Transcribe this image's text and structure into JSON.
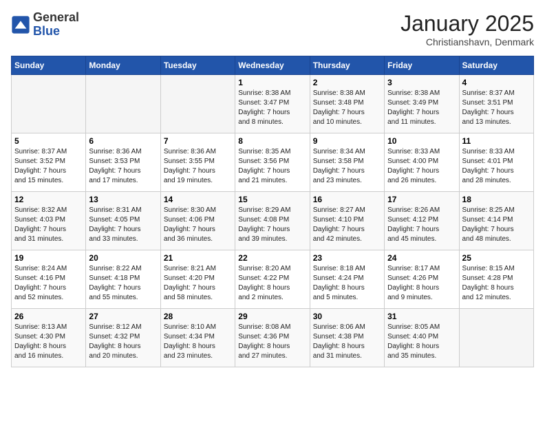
{
  "logo": {
    "general": "General",
    "blue": "Blue"
  },
  "title": "January 2025",
  "subtitle": "Christianshavn, Denmark",
  "weekdays": [
    "Sunday",
    "Monday",
    "Tuesday",
    "Wednesday",
    "Thursday",
    "Friday",
    "Saturday"
  ],
  "weeks": [
    [
      {
        "day": "",
        "info": ""
      },
      {
        "day": "",
        "info": ""
      },
      {
        "day": "",
        "info": ""
      },
      {
        "day": "1",
        "info": "Sunrise: 8:38 AM\nSunset: 3:47 PM\nDaylight: 7 hours\nand 8 minutes."
      },
      {
        "day": "2",
        "info": "Sunrise: 8:38 AM\nSunset: 3:48 PM\nDaylight: 7 hours\nand 10 minutes."
      },
      {
        "day": "3",
        "info": "Sunrise: 8:38 AM\nSunset: 3:49 PM\nDaylight: 7 hours\nand 11 minutes."
      },
      {
        "day": "4",
        "info": "Sunrise: 8:37 AM\nSunset: 3:51 PM\nDaylight: 7 hours\nand 13 minutes."
      }
    ],
    [
      {
        "day": "5",
        "info": "Sunrise: 8:37 AM\nSunset: 3:52 PM\nDaylight: 7 hours\nand 15 minutes."
      },
      {
        "day": "6",
        "info": "Sunrise: 8:36 AM\nSunset: 3:53 PM\nDaylight: 7 hours\nand 17 minutes."
      },
      {
        "day": "7",
        "info": "Sunrise: 8:36 AM\nSunset: 3:55 PM\nDaylight: 7 hours\nand 19 minutes."
      },
      {
        "day": "8",
        "info": "Sunrise: 8:35 AM\nSunset: 3:56 PM\nDaylight: 7 hours\nand 21 minutes."
      },
      {
        "day": "9",
        "info": "Sunrise: 8:34 AM\nSunset: 3:58 PM\nDaylight: 7 hours\nand 23 minutes."
      },
      {
        "day": "10",
        "info": "Sunrise: 8:33 AM\nSunset: 4:00 PM\nDaylight: 7 hours\nand 26 minutes."
      },
      {
        "day": "11",
        "info": "Sunrise: 8:33 AM\nSunset: 4:01 PM\nDaylight: 7 hours\nand 28 minutes."
      }
    ],
    [
      {
        "day": "12",
        "info": "Sunrise: 8:32 AM\nSunset: 4:03 PM\nDaylight: 7 hours\nand 31 minutes."
      },
      {
        "day": "13",
        "info": "Sunrise: 8:31 AM\nSunset: 4:05 PM\nDaylight: 7 hours\nand 33 minutes."
      },
      {
        "day": "14",
        "info": "Sunrise: 8:30 AM\nSunset: 4:06 PM\nDaylight: 7 hours\nand 36 minutes."
      },
      {
        "day": "15",
        "info": "Sunrise: 8:29 AM\nSunset: 4:08 PM\nDaylight: 7 hours\nand 39 minutes."
      },
      {
        "day": "16",
        "info": "Sunrise: 8:27 AM\nSunset: 4:10 PM\nDaylight: 7 hours\nand 42 minutes."
      },
      {
        "day": "17",
        "info": "Sunrise: 8:26 AM\nSunset: 4:12 PM\nDaylight: 7 hours\nand 45 minutes."
      },
      {
        "day": "18",
        "info": "Sunrise: 8:25 AM\nSunset: 4:14 PM\nDaylight: 7 hours\nand 48 minutes."
      }
    ],
    [
      {
        "day": "19",
        "info": "Sunrise: 8:24 AM\nSunset: 4:16 PM\nDaylight: 7 hours\nand 52 minutes."
      },
      {
        "day": "20",
        "info": "Sunrise: 8:22 AM\nSunset: 4:18 PM\nDaylight: 7 hours\nand 55 minutes."
      },
      {
        "day": "21",
        "info": "Sunrise: 8:21 AM\nSunset: 4:20 PM\nDaylight: 7 hours\nand 58 minutes."
      },
      {
        "day": "22",
        "info": "Sunrise: 8:20 AM\nSunset: 4:22 PM\nDaylight: 8 hours\nand 2 minutes."
      },
      {
        "day": "23",
        "info": "Sunrise: 8:18 AM\nSunset: 4:24 PM\nDaylight: 8 hours\nand 5 minutes."
      },
      {
        "day": "24",
        "info": "Sunrise: 8:17 AM\nSunset: 4:26 PM\nDaylight: 8 hours\nand 9 minutes."
      },
      {
        "day": "25",
        "info": "Sunrise: 8:15 AM\nSunset: 4:28 PM\nDaylight: 8 hours\nand 12 minutes."
      }
    ],
    [
      {
        "day": "26",
        "info": "Sunrise: 8:13 AM\nSunset: 4:30 PM\nDaylight: 8 hours\nand 16 minutes."
      },
      {
        "day": "27",
        "info": "Sunrise: 8:12 AM\nSunset: 4:32 PM\nDaylight: 8 hours\nand 20 minutes."
      },
      {
        "day": "28",
        "info": "Sunrise: 8:10 AM\nSunset: 4:34 PM\nDaylight: 8 hours\nand 23 minutes."
      },
      {
        "day": "29",
        "info": "Sunrise: 8:08 AM\nSunset: 4:36 PM\nDaylight: 8 hours\nand 27 minutes."
      },
      {
        "day": "30",
        "info": "Sunrise: 8:06 AM\nSunset: 4:38 PM\nDaylight: 8 hours\nand 31 minutes."
      },
      {
        "day": "31",
        "info": "Sunrise: 8:05 AM\nSunset: 4:40 PM\nDaylight: 8 hours\nand 35 minutes."
      },
      {
        "day": "",
        "info": ""
      }
    ]
  ]
}
